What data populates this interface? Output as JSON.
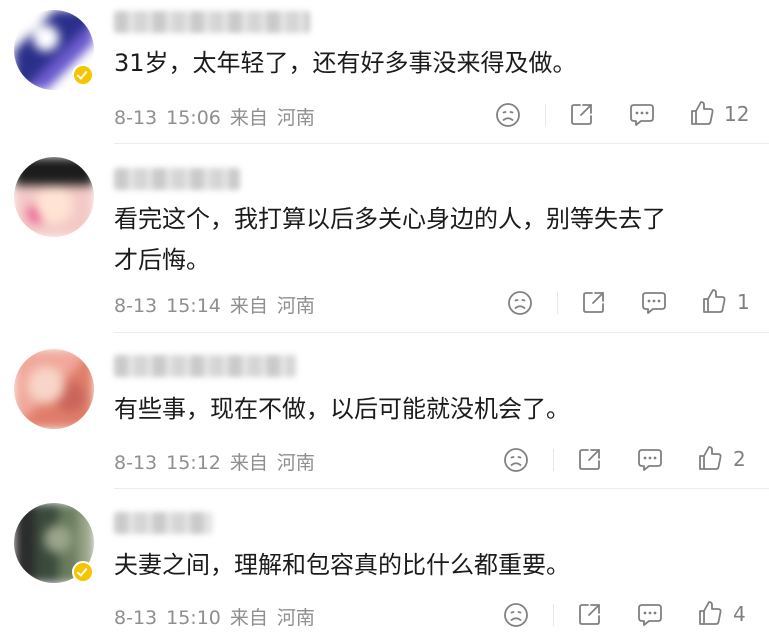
{
  "comments": [
    {
      "text": "31岁，太年轻了，还有好多事没来得及做。",
      "date": "8-13",
      "time": "15:06",
      "source_label": "来自",
      "location": "河南",
      "likes": "12",
      "verified": true,
      "avatar_colors": [
        "#2b2f8a",
        "#f4c21a",
        "#6a5acd",
        "#ffffff"
      ]
    },
    {
      "text": "看完这个，我打算以后多关心身边的人，别等失去了\n才后悔。",
      "date": "8-13",
      "time": "15:14",
      "source_label": "来自",
      "location": "河南",
      "likes": "1",
      "verified": false,
      "avatar_colors": [
        "#f3c9c6",
        "#1c1c1c",
        "#e74a8a",
        "#ffe3d3"
      ]
    },
    {
      "text": "有些事，现在不做，以后可能就没机会了。",
      "date": "8-13",
      "time": "15:12",
      "source_label": "来自",
      "location": "河南",
      "likes": "2",
      "verified": false,
      "avatar_colors": [
        "#f0a89a",
        "#e07d6a",
        "#f7d5c8",
        "#c9655a"
      ]
    },
    {
      "text": "夫妻之间，理解和包容真的比什么都重要。",
      "date": "8-13",
      "time": "15:10",
      "source_label": "来自",
      "location": "河南",
      "likes": "4",
      "verified": true,
      "avatar_colors": [
        "#3a4a3c",
        "#6a7c5e",
        "#9aa58a",
        "#2a2a2a"
      ]
    }
  ],
  "icons": {
    "emoji": "sad-face-icon",
    "repost": "share-icon",
    "reply": "comment-icon",
    "like": "thumbs-up-icon"
  },
  "colors": {
    "text": "#1b1b1b",
    "meta": "#8f8f8f",
    "icon": "#808080",
    "divider": "#ececec",
    "verified_badge": "#f7c400"
  }
}
